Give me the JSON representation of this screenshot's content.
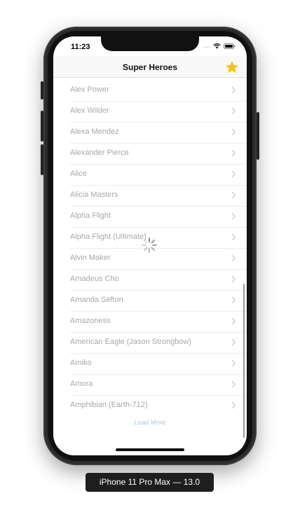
{
  "status_bar": {
    "time": "11:23",
    "signal": "....",
    "icons": [
      "wifi-icon",
      "battery-icon"
    ]
  },
  "navbar": {
    "title": "Super Heroes",
    "favorite_icon": "star-icon",
    "favorite_color": "#f5c518"
  },
  "heroes": [
    "Alex Power",
    "Alex Wilder",
    "Alexa Mendez",
    "Alexander Pierce",
    "Alice",
    "Alicia Masters",
    "Alpha Flight",
    "Alpha Flight (Ultimate)",
    "Alvin Maker",
    "Amadeus Cho",
    "Amanda Sefton",
    "Amazoness",
    "American Eagle (Jason Strongbow)",
    "Amiko",
    "Amora",
    "Amphibian (Earth-712)"
  ],
  "load_more_label": "Load More",
  "loading_indicator": "spinner-icon",
  "device_label": "iPhone 11 Pro Max — 13.0",
  "colors": {
    "row_text": "#a8a8a8",
    "load_more": "#a9cbe8",
    "star": "#f5c518"
  }
}
